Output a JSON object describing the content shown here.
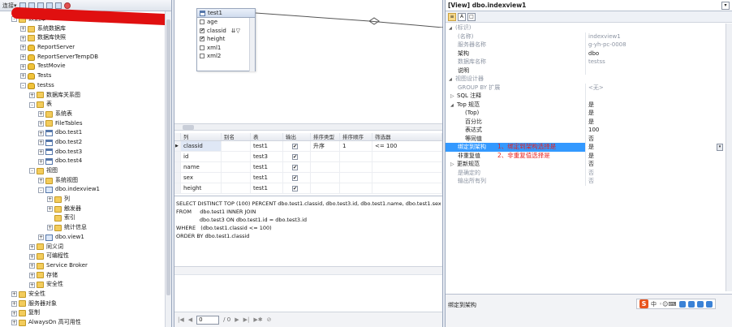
{
  "explorer": {
    "toolbar_label": "连接▾",
    "tree": [
      {
        "label": "数据库",
        "indent": 1,
        "icon": "folder",
        "exp": "-"
      },
      {
        "label": "系统数据库",
        "indent": 2,
        "icon": "folder",
        "exp": "+"
      },
      {
        "label": "数据库快照",
        "indent": 2,
        "icon": "folder",
        "exp": "+"
      },
      {
        "label": "ReportServer",
        "indent": 2,
        "icon": "db",
        "exp": "+"
      },
      {
        "label": "ReportServerTempDB",
        "indent": 2,
        "icon": "db",
        "exp": "+"
      },
      {
        "label": "TestMovie",
        "indent": 2,
        "icon": "db",
        "exp": "+"
      },
      {
        "label": "Tests",
        "indent": 2,
        "icon": "db",
        "exp": "+"
      },
      {
        "label": "testss",
        "indent": 2,
        "icon": "db",
        "exp": "-"
      },
      {
        "label": "数据库关系图",
        "indent": 3,
        "icon": "folder",
        "exp": "+"
      },
      {
        "label": "表",
        "indent": 3,
        "icon": "folder",
        "exp": "-"
      },
      {
        "label": "系统表",
        "indent": 4,
        "icon": "folder",
        "exp": "+"
      },
      {
        "label": "FileTables",
        "indent": 4,
        "icon": "folder",
        "exp": "+"
      },
      {
        "label": "dbo.test1",
        "indent": 4,
        "icon": "table",
        "exp": "+"
      },
      {
        "label": "dbo.test2",
        "indent": 4,
        "icon": "table",
        "exp": "+"
      },
      {
        "label": "dbo.test3",
        "indent": 4,
        "icon": "table",
        "exp": "+"
      },
      {
        "label": "dbo.test4",
        "indent": 4,
        "icon": "table",
        "exp": "+"
      },
      {
        "label": "视图",
        "indent": 3,
        "icon": "folder",
        "exp": "-"
      },
      {
        "label": "系统视图",
        "indent": 4,
        "icon": "folder",
        "exp": "+"
      },
      {
        "label": "dbo.indexview1",
        "indent": 4,
        "icon": "view",
        "exp": "-"
      },
      {
        "label": "列",
        "indent": 5,
        "icon": "folder",
        "exp": "+"
      },
      {
        "label": "触发器",
        "indent": 5,
        "icon": "folder",
        "exp": "+"
      },
      {
        "label": "索引",
        "indent": 5,
        "icon": "folder",
        "exp": ""
      },
      {
        "label": "统计信息",
        "indent": 5,
        "icon": "folder",
        "exp": "+"
      },
      {
        "label": "dbo.view1",
        "indent": 4,
        "icon": "view",
        "exp": "+"
      },
      {
        "label": "同义词",
        "indent": 3,
        "icon": "folder",
        "exp": "+"
      },
      {
        "label": "可编程性",
        "indent": 3,
        "icon": "folder",
        "exp": "+"
      },
      {
        "label": "Service Broker",
        "indent": 3,
        "icon": "folder",
        "exp": "+"
      },
      {
        "label": "存储",
        "indent": 3,
        "icon": "folder",
        "exp": "+"
      },
      {
        "label": "安全性",
        "indent": 3,
        "icon": "folder",
        "exp": "+"
      },
      {
        "label": "安全性",
        "indent": 1,
        "icon": "folder",
        "exp": "+"
      },
      {
        "label": "服务器对象",
        "indent": 1,
        "icon": "folder",
        "exp": "+"
      },
      {
        "label": "复制",
        "indent": 1,
        "icon": "folder",
        "exp": "+"
      },
      {
        "label": "AlwaysOn 高可用性",
        "indent": 1,
        "icon": "folder",
        "exp": "+"
      }
    ]
  },
  "diagram": {
    "table_name": "test1",
    "columns": [
      {
        "name": "age",
        "checked": false,
        "sort": ""
      },
      {
        "name": "classid",
        "checked": true,
        "sort": "⇊▽"
      },
      {
        "name": "height",
        "checked": true,
        "sort": ""
      },
      {
        "name": "xml1",
        "checked": false,
        "sort": ""
      },
      {
        "name": "xml2",
        "checked": false,
        "sort": ""
      }
    ]
  },
  "grid": {
    "headers": [
      "列",
      "别名",
      "表",
      "输出",
      "排序类型",
      "排序顺序",
      "筛选器"
    ],
    "rows": [
      {
        "col": "classid",
        "alias": "",
        "table": "test1",
        "output": true,
        "sort_type": "升序",
        "sort_order": "1",
        "filter": "<= 100",
        "current": true
      },
      {
        "col": "id",
        "alias": "",
        "table": "test3",
        "output": true,
        "sort_type": "",
        "sort_order": "",
        "filter": "",
        "current": false
      },
      {
        "col": "name",
        "alias": "",
        "table": "test1",
        "output": true,
        "sort_type": "",
        "sort_order": "",
        "filter": "",
        "current": false
      },
      {
        "col": "sex",
        "alias": "",
        "table": "test1",
        "output": true,
        "sort_type": "",
        "sort_order": "",
        "filter": "",
        "current": false
      },
      {
        "col": "height",
        "alias": "",
        "table": "test1",
        "output": true,
        "sort_type": "",
        "sort_order": "",
        "filter": "",
        "current": false
      }
    ]
  },
  "sql": {
    "lines": [
      "SELECT DISTINCT TOP (100) PERCENT dbo.test1.classid, dbo.test3.id, dbo.test1.name, dbo.test1.sex,",
      "FROM     dbo.test1 INNER JOIN",
      "              dbo.test3 ON dbo.test1.id = dbo.test3.id",
      "WHERE   (dbo.test1.classid <= 100)",
      "ORDER BY dbo.test1.classid"
    ]
  },
  "nav": {
    "first": "|◀",
    "prev": "◀",
    "page_value": "0",
    "of": "/ 0",
    "next": "▶",
    "last": "▶|",
    "new": "▶✱",
    "stop": "⊘"
  },
  "props": {
    "title": "[View] dbo.indexview1",
    "title_dropdown": "▾",
    "rows": [
      {
        "name": "(标识)",
        "value": "",
        "kind": "cat"
      },
      {
        "name": "(名称)",
        "value": "indexview1",
        "kind": "dim"
      },
      {
        "name": "服务器名称",
        "value": "g-yh-pc-0008",
        "kind": "dim"
      },
      {
        "name": "架构",
        "value": "dbo",
        "kind": ""
      },
      {
        "name": "数据库名称",
        "value": "testss",
        "kind": "dim"
      },
      {
        "name": "说明",
        "value": "",
        "kind": ""
      },
      {
        "name": "视图设计器",
        "value": "",
        "kind": "cat"
      },
      {
        "name": "GROUP BY 扩展",
        "value": "<无>",
        "kind": "dim"
      },
      {
        "name": "SQL 注释",
        "value": "",
        "kind": "plus"
      },
      {
        "name": "Top 规范",
        "value": "是",
        "kind": "open"
      },
      {
        "name": "(Top)",
        "value": "是",
        "kind": "sub"
      },
      {
        "name": "百分比",
        "value": "是",
        "kind": "sub"
      },
      {
        "name": "表达式",
        "value": "100",
        "kind": "sub"
      },
      {
        "name": "等同值",
        "value": "否",
        "kind": "sub"
      },
      {
        "name": "绑定到架构",
        "value": "是",
        "kind": "sel"
      },
      {
        "name": "非重复值",
        "value": "是",
        "kind": ""
      },
      {
        "name": "更新规范",
        "value": "否",
        "kind": "plus"
      },
      {
        "name": "是确定的",
        "value": "否",
        "kind": "dim"
      },
      {
        "name": "输出所有列",
        "value": "否",
        "kind": "dim"
      }
    ],
    "annotation_lines": [
      "1、绑定到架构选择是",
      "2、非重复值选择是"
    ],
    "description": "绑定到架构",
    "value_dropdown": "▾"
  },
  "ime": {
    "logo": "S",
    "label": "中",
    "glyphs": "◦☺⌨"
  },
  "colors": {
    "selection": "#3399ff",
    "annotation": "#e8201c",
    "redaction": "#e01010"
  }
}
